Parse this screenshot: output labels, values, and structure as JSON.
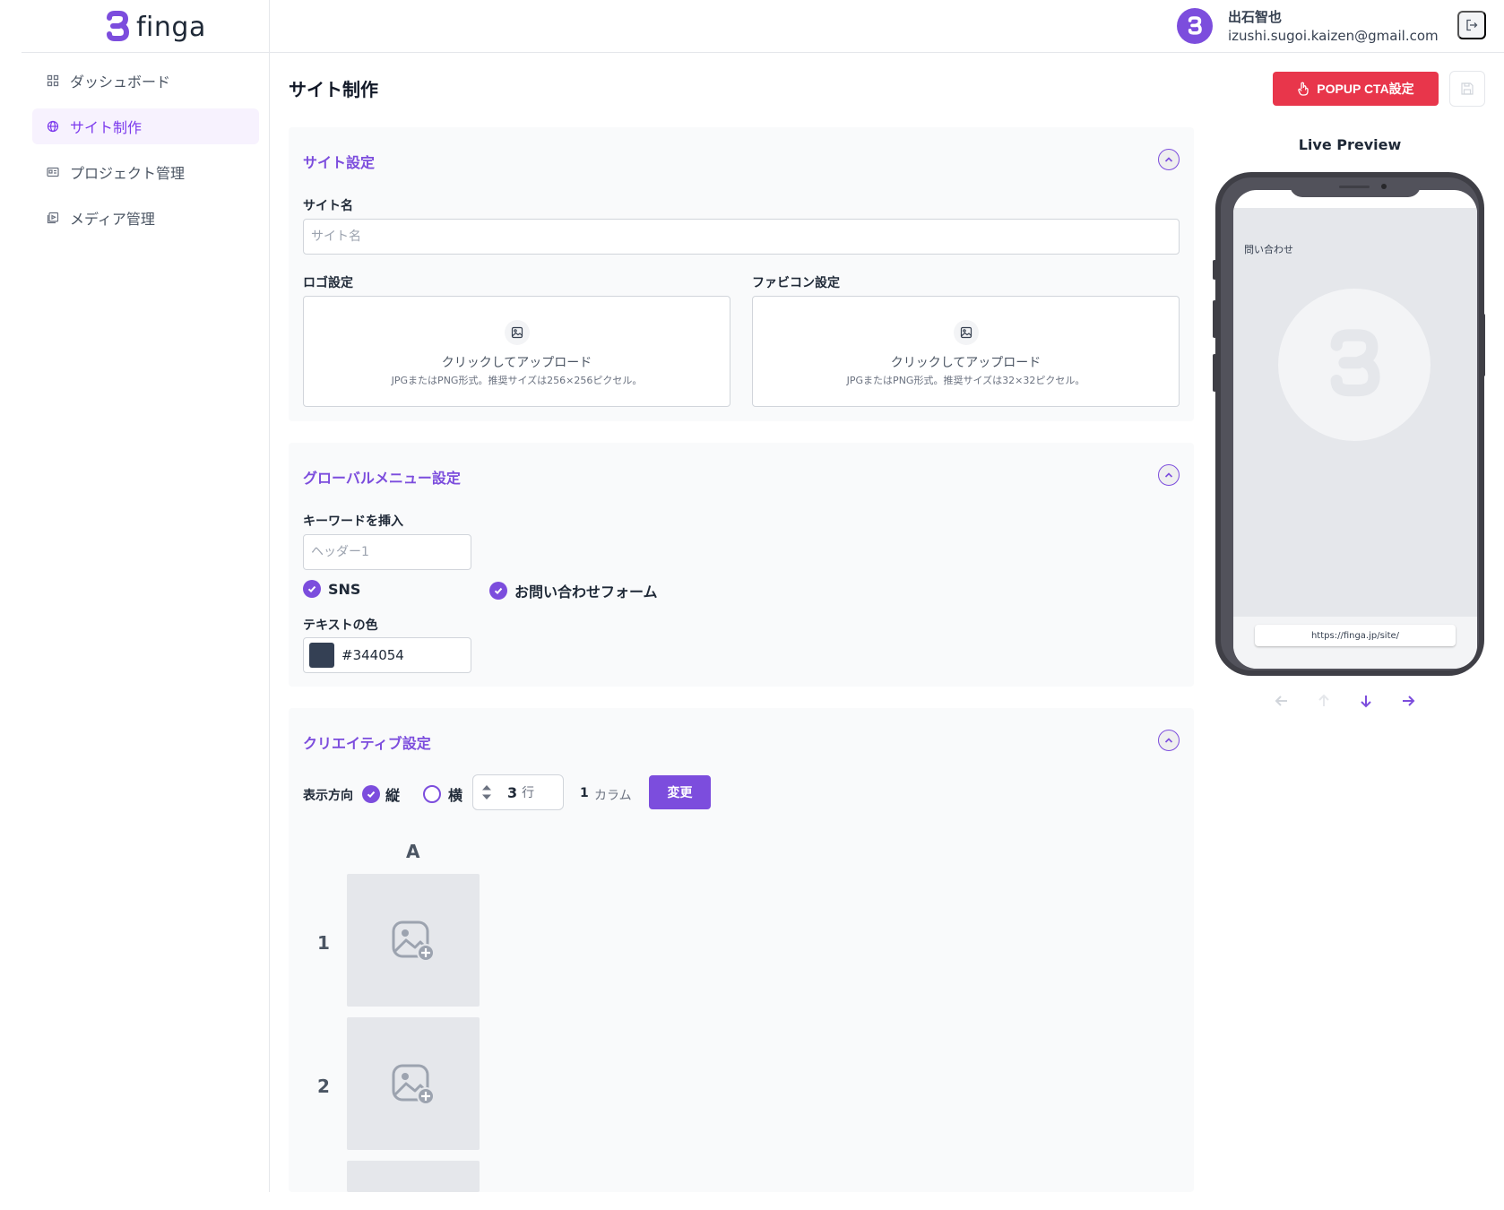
{
  "brand": {
    "name": "finga",
    "accent": "#7c4ddd"
  },
  "sidebar": {
    "items": [
      {
        "label": "ダッシュボード",
        "icon": "dashboard-grid-icon",
        "active": false
      },
      {
        "label": "サイト制作",
        "icon": "globe-icon",
        "active": true
      },
      {
        "label": "プロジェクト管理",
        "icon": "project-card-icon",
        "active": false
      },
      {
        "label": "メディア管理",
        "icon": "media-library-icon",
        "active": false
      }
    ]
  },
  "user": {
    "name": "出石智也",
    "email": "izushi.sugoi.kaizen@gmail.com"
  },
  "page": {
    "title": "サイト制作",
    "popup_button": "POPUP CTA設定"
  },
  "site_settings": {
    "title": "サイト設定",
    "site_name_label": "サイト名",
    "site_name_placeholder": "サイト名",
    "logo_label": "ロゴ設定",
    "logo_upload_title": "クリックしてアップロード",
    "logo_upload_hint": "JPGまたはPNG形式。推奨サイズは256×256ピクセル。",
    "favicon_label": "ファビコン設定",
    "favicon_upload_title": "クリックしてアップロード",
    "favicon_upload_hint": "JPGまたはPNG形式。推奨サイズは32×32ピクセル。"
  },
  "global_menu": {
    "title": "グローバルメニュー設定",
    "keyword_label": "キーワードを挿入",
    "keyword_placeholder": "ヘッダー1",
    "sns_label": "SNS",
    "sns_checked": true,
    "contact_label": "お問い合わせフォーム",
    "contact_checked": true,
    "text_color_label": "テキストの色",
    "text_color_value": "#344054"
  },
  "creative": {
    "title": "クリエイティブ設定",
    "direction_label": "表示方向",
    "vertical_label": "縦",
    "vertical_selected": true,
    "horizontal_label": "横",
    "rows_value": "3",
    "rows_unit": "行",
    "columns_value": "1",
    "columns_unit": "カラム",
    "change_button": "変更",
    "grid": {
      "column_labels": [
        "A"
      ],
      "row_labels": [
        "1",
        "2"
      ]
    }
  },
  "preview": {
    "title": "Live Preview",
    "screen_label": "問い合わせ",
    "url": "https://finga.jp/site/"
  }
}
